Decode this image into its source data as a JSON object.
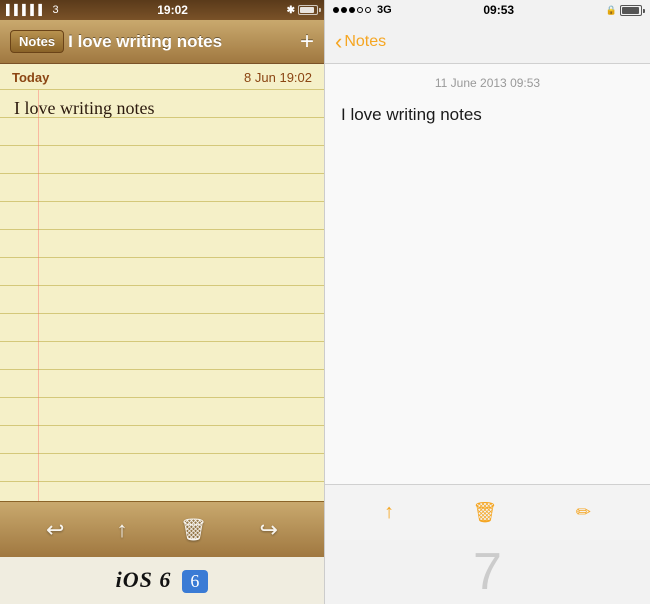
{
  "ios6": {
    "status": {
      "signal": "....3",
      "carrier": "",
      "time": "19:02",
      "bluetooth": "✱"
    },
    "navbar": {
      "back_label": "Notes",
      "title": "I love writing notes",
      "add_button": "+"
    },
    "date_bar": {
      "left": "Today",
      "right": "8 Jun  19:02"
    },
    "note_text": "I love writing notes",
    "label": "iOS 6"
  },
  "ios7": {
    "status": {
      "signal_dots": 3,
      "carrier": "3G",
      "time": "09:53",
      "lock": "🔒"
    },
    "navbar": {
      "back_label": "Notes"
    },
    "date": "11 June 2013 09:53",
    "note_text": "I love writing notes",
    "toolbar": {
      "share": "share",
      "trash": "trash",
      "compose": "compose"
    },
    "logo": "7"
  }
}
